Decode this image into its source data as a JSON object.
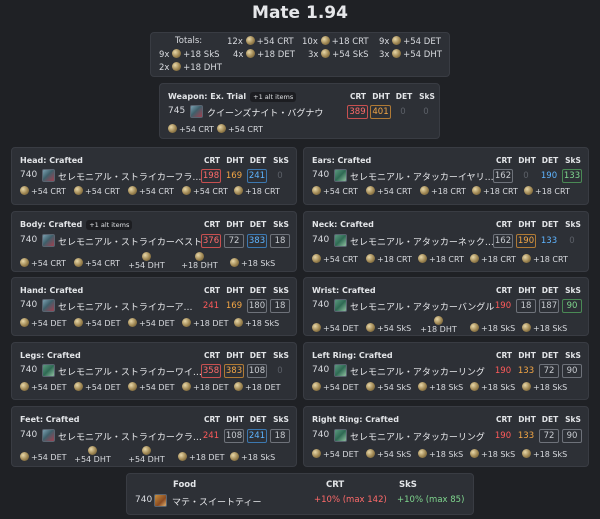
{
  "title": "Mate 1.94",
  "totals": {
    "label": "Totals:",
    "items": [
      {
        "count": "12x",
        "text": "+54 CRT"
      },
      {
        "count": "10x",
        "text": "+18 CRT"
      },
      {
        "count": "9x",
        "text": "+54 DET"
      },
      {
        "count": "9x",
        "text": "+18 SkS"
      },
      {
        "count": "4x",
        "text": "+18 DET"
      },
      {
        "count": "3x",
        "text": "+54 SkS"
      },
      {
        "count": "3x",
        "text": "+54 DHT"
      },
      {
        "count": "2x",
        "text": "+18 DHT"
      }
    ]
  },
  "cols": {
    "crt": "CRT",
    "dht": "DHT",
    "det": "DET",
    "sks": "SkS"
  },
  "weapon": {
    "header": "Weapon: Ex. Trial",
    "badge": "+1 alt items",
    "ilvl": "745",
    "name": "クイーンズナイト・バグナウ",
    "crt": "389",
    "dht": "401",
    "det": "0",
    "sks": "0",
    "materia": [
      "+54 CRT",
      "+54 CRT"
    ]
  },
  "slots": {
    "head": {
      "header": "Head: Crafted",
      "ilvl": "740",
      "name": "セレモニアル・ストライカーフラ…",
      "crt": "198",
      "dht": "169",
      "det": "241",
      "sks": "0",
      "materia": [
        "+54 CRT",
        "+54 CRT",
        "+54 CRT",
        "+54 CRT",
        "+18 CRT"
      ]
    },
    "ears": {
      "header": "Ears: Crafted",
      "ilvl": "740",
      "name": "セレモニアル・アタッカーイヤリ…",
      "crt": "162",
      "dht": "0",
      "det": "190",
      "sks": "133",
      "materia": [
        "+54 CRT",
        "+54 CRT",
        "+18 CRT",
        "+18 CRT",
        "+18 CRT"
      ]
    },
    "body": {
      "header": "Body: Crafted",
      "badge": "+1 alt items",
      "ilvl": "740",
      "name": "セレモニアル・ストライカーベスト",
      "crt": "376",
      "dht": "72",
      "det": "383",
      "sks": "18",
      "materia": [
        "+54 CRT",
        "+54 CRT",
        "+54 DHT",
        "+18 DHT",
        "+18 SkS"
      ]
    },
    "neck": {
      "header": "Neck: Crafted",
      "ilvl": "740",
      "name": "セレモニアル・アタッカーネック…",
      "crt": "162",
      "dht": "190",
      "det": "133",
      "sks": "0",
      "materia": [
        "+54 CRT",
        "+18 CRT",
        "+18 CRT",
        "+18 CRT",
        "+18 CRT"
      ]
    },
    "hands": {
      "header": "Hand: Crafted",
      "ilvl": "740",
      "name": "セレモニアル・ストライカーア…",
      "crt": "241",
      "dht": "169",
      "det": "180",
      "sks": "18",
      "materia": [
        "+54 DET",
        "+54 DET",
        "+54 DET",
        "+18 DET",
        "+18 SkS"
      ]
    },
    "wrist": {
      "header": "Wrist: Crafted",
      "ilvl": "740",
      "name": "セレモニアル・アタッカーバングル",
      "crt": "190",
      "dht": "18",
      "det": "187",
      "sks": "90",
      "materia": [
        "+54 DET",
        "+54 SkS",
        "+18 DHT",
        "+18 SkS",
        "+18 SkS"
      ]
    },
    "legs": {
      "header": "Legs: Crafted",
      "ilvl": "740",
      "name": "セレモニアル・ストライカーワイ…",
      "crt": "358",
      "dht": "383",
      "det": "108",
      "sks": "0",
      "materia": [
        "+54 DET",
        "+54 DET",
        "+54 DET",
        "+18 DET",
        "+18 DET"
      ]
    },
    "ring_left": {
      "header": "Left Ring: Crafted",
      "ilvl": "740",
      "name": "セレモニアル・アタッカーリング",
      "crt": "190",
      "dht": "133",
      "det": "72",
      "sks": "90",
      "materia": [
        "+54 DET",
        "+54 SkS",
        "+18 SkS",
        "+18 SkS",
        "+18 SkS"
      ]
    },
    "feet": {
      "header": "Feet: Crafted",
      "ilvl": "740",
      "name": "セレモニアル・ストライカークラ…",
      "crt": "241",
      "dht": "108",
      "det": "241",
      "sks": "18",
      "materia": [
        "+54 DET",
        "+54 DHT",
        "+54 DHT",
        "+18 DET",
        "+18 SkS"
      ]
    },
    "ring_right": {
      "header": "Right Ring: Crafted",
      "ilvl": "740",
      "name": "セレモニアル・アタッカーリング",
      "crt": "190",
      "dht": "133",
      "det": "72",
      "sks": "90",
      "materia": [
        "+54 DET",
        "+54 SkS",
        "+18 SkS",
        "+18 SkS",
        "+18 SkS"
      ]
    }
  },
  "food": {
    "header": "Food",
    "ilvl": "740",
    "name": "マテ・スイートティー",
    "col1": "CRT",
    "col2": "SkS",
    "val1": "+10% (max 142)",
    "val2": "+10% (max 85)"
  },
  "colors": {
    "background": "#1f2125",
    "card": "#2d3036",
    "red": "#ff6a6a",
    "orange": "#f3a645",
    "blue": "#5eb4ff",
    "green": "#7fd68e"
  }
}
